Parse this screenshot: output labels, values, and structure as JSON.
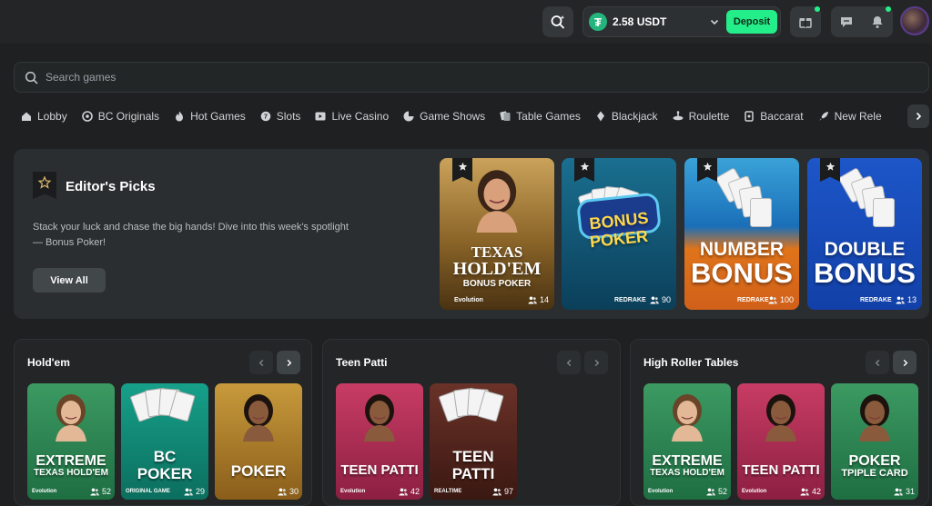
{
  "topbar": {
    "balance": "2.58 USDT",
    "deposit_label": "Deposit",
    "icons": [
      "search-sparkle-icon",
      "gift-icon",
      "chat-icon",
      "bell-icon"
    ]
  },
  "search": {
    "placeholder": "Search games"
  },
  "categories": [
    {
      "label": "Lobby",
      "icon": "home-icon"
    },
    {
      "label": "BC Originals",
      "icon": "originals-icon"
    },
    {
      "label": "Hot Games",
      "icon": "flame-icon"
    },
    {
      "label": "Slots",
      "icon": "slots-icon"
    },
    {
      "label": "Live Casino",
      "icon": "live-icon"
    },
    {
      "label": "Game Shows",
      "icon": "game-shows-icon"
    },
    {
      "label": "Table Games",
      "icon": "table-games-icon"
    },
    {
      "label": "Blackjack",
      "icon": "blackjack-icon"
    },
    {
      "label": "Roulette",
      "icon": "roulette-icon"
    },
    {
      "label": "Baccarat",
      "icon": "baccarat-icon"
    },
    {
      "label": "New Rele",
      "icon": "rocket-icon"
    }
  ],
  "editors_picks": {
    "title": "Editor's Picks",
    "description": "Stack your luck and chase the big hands! Dive into this week's spotlight — Bonus Poker!",
    "view_all": "View All",
    "cards": [
      {
        "line1": "TEXAS",
        "line2": "HOLD'EM",
        "line3": "BONUS POKER",
        "provider": "Evolution",
        "players": "14",
        "bg": "#9a7a3c"
      },
      {
        "line1": "BONUS",
        "line2": "POKER",
        "line3": "",
        "provider": "REDRAKE",
        "players": "90",
        "bg": "#1c6c8c"
      },
      {
        "line1": "NUMBER",
        "line2": "BONUS",
        "line3": "",
        "provider": "REDRAKE",
        "players": "100",
        "bg": "#d8731c"
      },
      {
        "line1": "DOUBLE",
        "line2": "BONUS",
        "line3": "",
        "provider": "REDRAKE",
        "players": "13",
        "bg": "#1f5fd0"
      }
    ]
  },
  "sections": [
    {
      "title": "Hold'em",
      "games": [
        {
          "line1": "EXTREME",
          "line2": "TEXAS HOLD'EM",
          "provider": "Evolution",
          "players": "52",
          "bg": "#2e8a55"
        },
        {
          "line1": "BC",
          "line2": "POKER",
          "provider": "ORIGINAL GAME",
          "players": "29",
          "bg": "#138c7a"
        },
        {
          "line1": "POKER",
          "line2": "",
          "provider": "",
          "players": "30",
          "bg": "#b8862f"
        }
      ]
    },
    {
      "title": "Teen Patti",
      "games": [
        {
          "line1": "TEEN PATTI",
          "line2": "",
          "provider": "Evolution",
          "players": "42",
          "bg": "#b42f57"
        },
        {
          "line1": "TEEN",
          "line2": "PATTI",
          "provider": "REALTIME",
          "players": "97",
          "bg": "#5a2a22"
        }
      ]
    },
    {
      "title": "High Roller Tables",
      "games": [
        {
          "line1": "EXTREME",
          "line2": "TEXAS HOLD'EM",
          "provider": "Evolution",
          "players": "52",
          "bg": "#2e8a55"
        },
        {
          "line1": "TEEN PATTI",
          "line2": "",
          "provider": "Evolution",
          "players": "42",
          "bg": "#b42f57"
        },
        {
          "line1": "POKER",
          "line2": "TPIPLE CARD",
          "provider": "",
          "players": "31",
          "bg": "#2c8a52"
        }
      ]
    }
  ]
}
